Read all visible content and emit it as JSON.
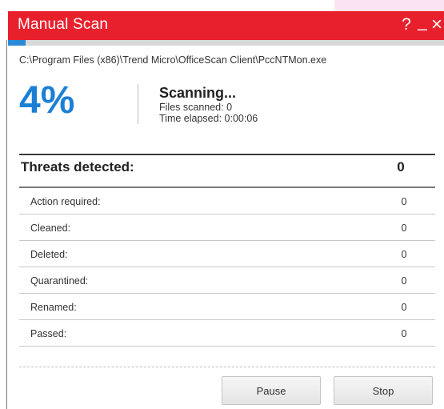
{
  "window": {
    "title": "Manual Scan",
    "help_label": "?",
    "minimize_label": "_",
    "close_label": "×",
    "accent_color": "#e8202c"
  },
  "scan": {
    "progress_percent": 4,
    "percent_text": "4%",
    "current_file": "C:\\Program Files (x86)\\Trend Micro\\OfficeScan Client\\PccNTMon.exe",
    "status_title": "Scanning...",
    "files_scanned": "Files scanned: 0",
    "time_elapsed": "Time elapsed: 0:00:06"
  },
  "threats": {
    "label": "Threats detected:",
    "count": "0",
    "rows": [
      {
        "label": "Action required:",
        "value": "0"
      },
      {
        "label": "Cleaned:",
        "value": "0"
      },
      {
        "label": "Deleted:",
        "value": "0"
      },
      {
        "label": "Quarantined:",
        "value": "0"
      },
      {
        "label": "Renamed:",
        "value": "0"
      },
      {
        "label": "Passed:",
        "value": "0"
      }
    ]
  },
  "buttons": {
    "pause_label": "Pause",
    "stop_label": "Stop"
  }
}
